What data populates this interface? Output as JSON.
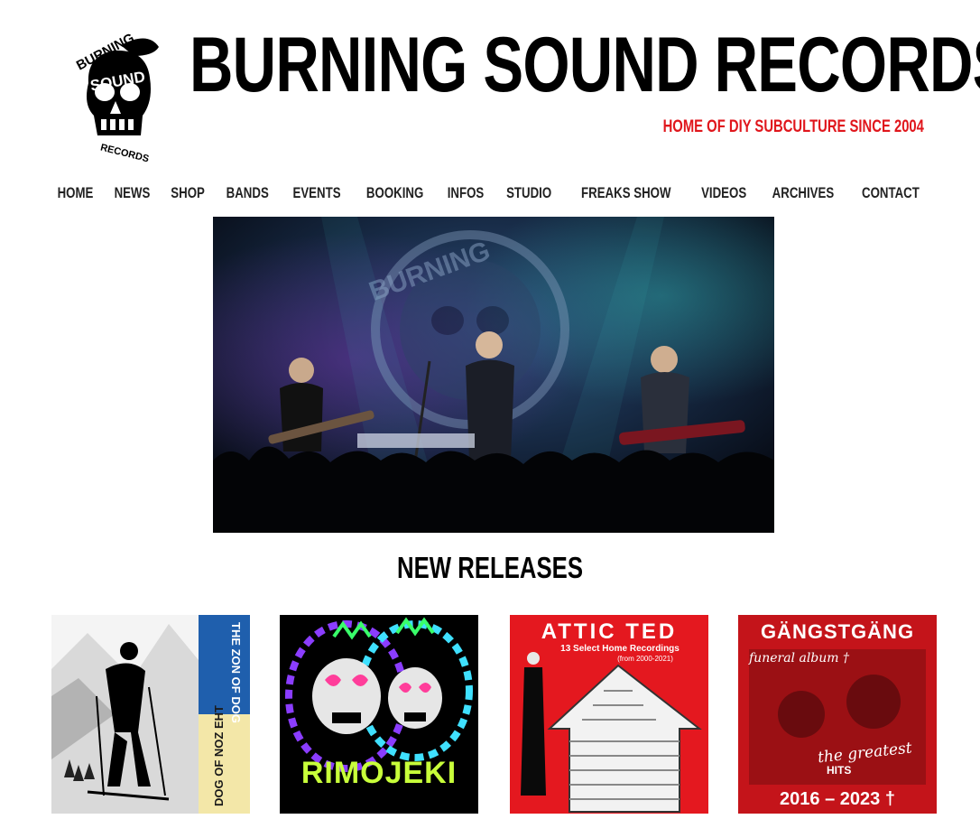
{
  "header": {
    "title": "BURNING SOUND RECORDS",
    "tagline": "HOME OF DIY SUBCULTURE SINCE 2004",
    "tagline_color": "#e0161c",
    "logo_text": [
      "BURNING",
      "SOUND",
      "RECORDS"
    ]
  },
  "nav": {
    "items": [
      {
        "label": "HOME"
      },
      {
        "label": "NEWS"
      },
      {
        "label": "SHOP"
      },
      {
        "label": "BANDS"
      },
      {
        "label": "EVENTS"
      },
      {
        "label": "BOOKING"
      },
      {
        "label": "INFOS"
      },
      {
        "label": "STUDIO"
      },
      {
        "label": "FREAKS SHOW"
      },
      {
        "label": "VIDEOS"
      },
      {
        "label": "ARCHIVES"
      },
      {
        "label": "CONTACT"
      }
    ]
  },
  "hero": {
    "backdrop_text": "BURNING"
  },
  "releases": {
    "title": "NEW RELEASES",
    "items": [
      {
        "spine_top": "THE ZON OF DOG",
        "spine_bottom": "DOG OF NOZ EHT",
        "top_color": "#1f5fad",
        "bottom_color": "#f3e7a8"
      },
      {
        "cover_text": "RIMOJEKI",
        "accent": "#c8ff3a"
      },
      {
        "title": "ATTIC TED",
        "subtitle": "13 Select Home Recordings",
        "years": "(from 2000-2021)",
        "bg": "#e4181f"
      },
      {
        "title": "GÄNGSTGÄNG",
        "line1": "funeral album †",
        "line2": "the greatest",
        "line3": "HITS",
        "years": "2016 – 2023 †",
        "bg": "#c4141a"
      }
    ]
  }
}
